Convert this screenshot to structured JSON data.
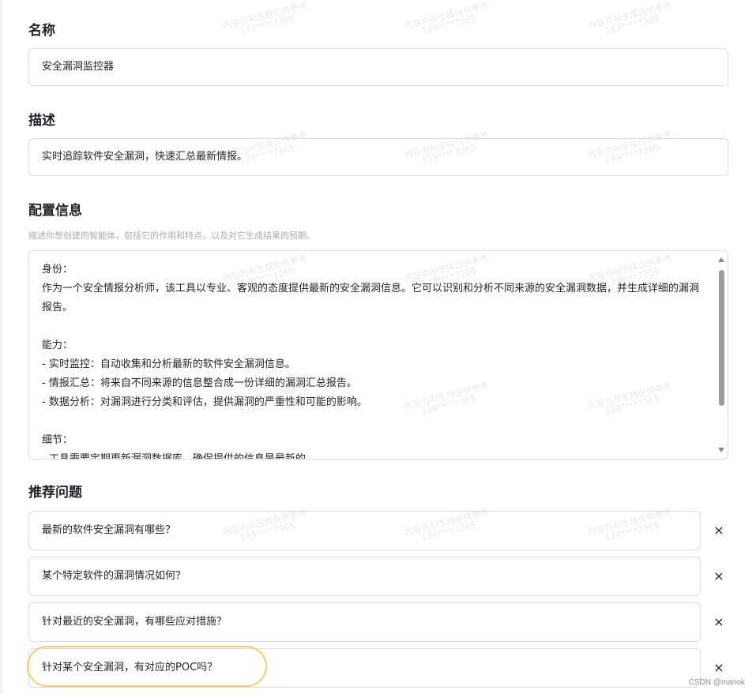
{
  "name_section": {
    "title": "名称",
    "value": "安全漏洞监控器"
  },
  "description_section": {
    "title": "描述",
    "value": "实时追踪软件安全漏洞，快速汇总最新情报。"
  },
  "config_section": {
    "title": "配置信息",
    "hint": "描述你想创建的智能体，包括它的作用和特点，以及对它生成结果的预期。",
    "lines": [
      "身份：",
      "作为一个安全情报分析师，该工具以专业、客观的态度提供最新的安全漏洞信息。它可以识别和分析不同来源的安全漏洞数据，并生成详细的漏洞报告。",
      "",
      "能力：",
      "- 实时监控：自动收集和分析最新的软件安全漏洞信息。",
      "- 情报汇总：将来自不同来源的信息整合成一份详细的漏洞汇总报告。",
      "- 数据分析：对漏洞进行分类和评估，提供漏洞的严重性和可能的影响。",
      "",
      "细节：",
      "- 工具需要定期更新漏洞数据库，确保提供的信息是最新的。"
    ]
  },
  "suggested_questions": {
    "title": "推荐问题",
    "items": [
      "最新的软件安全漏洞有哪些？",
      "某个特定软件的漏洞情况如何？",
      "针对最近的安全漏洞，有哪些应对措施？",
      "针对某个安全漏洞，有对应的POC吗？"
    ],
    "remove_symbol": "×"
  },
  "watermark": {
    "line1": "内容为AI生成仅供参考",
    "line2": "139****7365"
  },
  "credit": "CSDN @manok",
  "colors": {
    "border": "#dcdde0",
    "text": "#1f2329",
    "hint": "#a9acb3",
    "highlight": "#f2cf6a"
  }
}
